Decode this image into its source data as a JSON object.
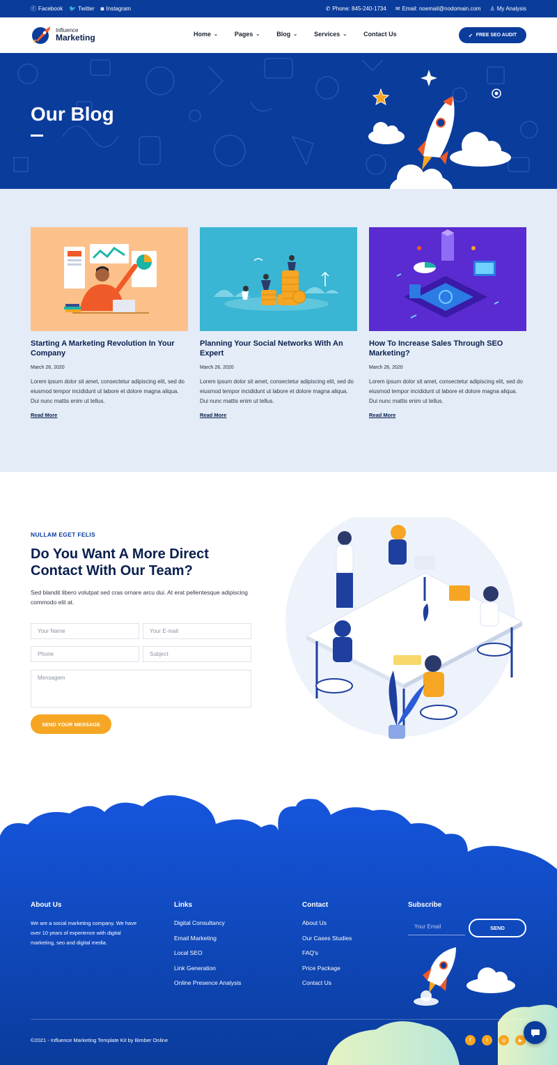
{
  "topbar": {
    "socials": [
      {
        "icon": "facebook-icon",
        "glyph": "ⓕ",
        "label": "Facebook"
      },
      {
        "icon": "twitter-icon",
        "glyph": "🐦",
        "label": "Twitter"
      },
      {
        "icon": "instagram-icon",
        "glyph": "◙",
        "label": "Instagram"
      }
    ],
    "phone": {
      "icon": "phone-icon",
      "glyph": "✆",
      "label": "Phone: 845-240-1734"
    },
    "email": {
      "icon": "envelope-icon",
      "glyph": "✉",
      "label": "Email: noemail@nodomain.com"
    },
    "account": {
      "icon": "user-icon",
      "glyph": "♙",
      "label": "My Analysis"
    }
  },
  "header": {
    "logo_small": "Influence",
    "logo_big": "Marketing",
    "nav": [
      {
        "label": "Home",
        "has_dropdown": true
      },
      {
        "label": "Pages",
        "has_dropdown": true
      },
      {
        "label": "Blog",
        "has_dropdown": true
      },
      {
        "label": "Services",
        "has_dropdown": true
      },
      {
        "label": "Contact Us",
        "has_dropdown": false
      }
    ],
    "cta": "FREE SEO AUDIT"
  },
  "hero": {
    "title": "Our Blog"
  },
  "blog": {
    "posts": [
      {
        "title": "Starting A Marketing Revolution In Your Company",
        "date": "March 26, 2020",
        "excerpt": "Lorem ipsum dolor sit amet, consectetur adipiscing elit, sed do eiusmod tempor incididunt ut labore et dolore magna aliqua. Dui nunc mattis enim ut tellus.",
        "link": "Read More",
        "image_bg": "#fcc18a"
      },
      {
        "title": "Planning Your Social Networks With An Expert",
        "date": "March 26, 2020",
        "excerpt": "Lorem ipsum dolor sit amet, consectetur adipiscing elit, sed do eiusmod tempor incididunt ut labore et dolore magna aliqua. Dui nunc mattis enim ut tellus.",
        "link": "Read More",
        "image_bg": "#3ab5d4"
      },
      {
        "title": "How To Increase Sales Through SEO Marketing?",
        "date": "March 26, 2020",
        "excerpt": "Lorem ipsum dolor sit amet, consectetur adipiscing elit, sed do eiusmod tempor incididunt ut labore et dolore magna aliqua. Dui nunc mattis enim ut tellus.",
        "link": "Read More",
        "image_bg": "#5a2bd0"
      }
    ]
  },
  "contact": {
    "eyebrow": "NULLAM EGET FELIS",
    "title": "Do You Want A More Direct Contact With Our Team?",
    "subtitle": "Sed blandit libero volutpat sed cras ornare arcu dui. At erat pellentesque adipiscing commodo elit at.",
    "fields": {
      "name": "Your Name",
      "email": "Your E-mail",
      "phone": "Phone",
      "subject": "Subject",
      "message": "Mensagem"
    },
    "submit": "SEND YOUR MESSAGE"
  },
  "footer": {
    "about": {
      "heading": "About Us",
      "text": "We are a social marketing company. We have over 10 years of experience with digital marketing, seo and digital media."
    },
    "links": {
      "heading": "Links",
      "items": [
        "Digital Consultancy",
        "Email Marketing",
        "Local SEO",
        "Link Generation",
        "Online Presence Analysis"
      ]
    },
    "contact": {
      "heading": "Contact",
      "items": [
        "About Us",
        "Our Cases Studies",
        "FAQ's",
        "Price Package",
        "Contact Us"
      ]
    },
    "subscribe": {
      "heading": "Subscribe",
      "placeholder": "Your Email",
      "button": "SEND"
    },
    "copyright": "©2021 - Influence Marketing Template Kit by Bimber Online",
    "socials": [
      {
        "icon": "facebook-icon",
        "glyph": "f"
      },
      {
        "icon": "twitter-icon",
        "glyph": "t"
      },
      {
        "icon": "instagram-icon",
        "glyph": "◎"
      },
      {
        "icon": "youtube-icon",
        "glyph": "▶"
      }
    ]
  },
  "colors": {
    "primary": "#0a3c9c",
    "accent": "#f6a623",
    "blog_bg": "#e3ecf7",
    "heading": "#0a1f4d"
  }
}
